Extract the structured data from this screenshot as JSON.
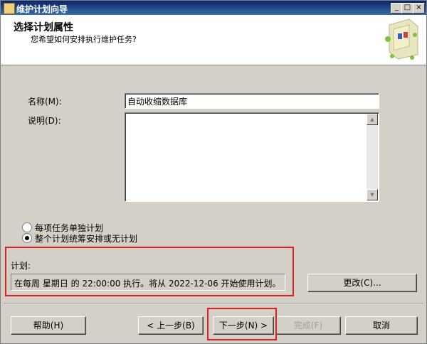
{
  "window": {
    "title": "维护计划向导"
  },
  "header": {
    "title": "选择计划属性",
    "subtitle": "您希望如何安排执行维护任务?"
  },
  "form": {
    "name_label": "名称(M):",
    "name_value": "自动收缩数据库",
    "desc_label": "说明(D):",
    "desc_value": ""
  },
  "options": {
    "separate": "每项任务单独计划",
    "single": "整个计划统筹安排或无计划",
    "selected": "single"
  },
  "schedule": {
    "label": "计划:",
    "value": "在每周 星期日 的 22:00:00 执行。将从 2022-12-06 开始使用计划。",
    "change_button": "更改(C)..."
  },
  "footer": {
    "help": "帮助(H)",
    "back": "< 上一步(B)",
    "next": "下一步(N) >",
    "finish": "完成(F)",
    "cancel": "取消"
  },
  "colors": {
    "highlight": "#e02020"
  }
}
